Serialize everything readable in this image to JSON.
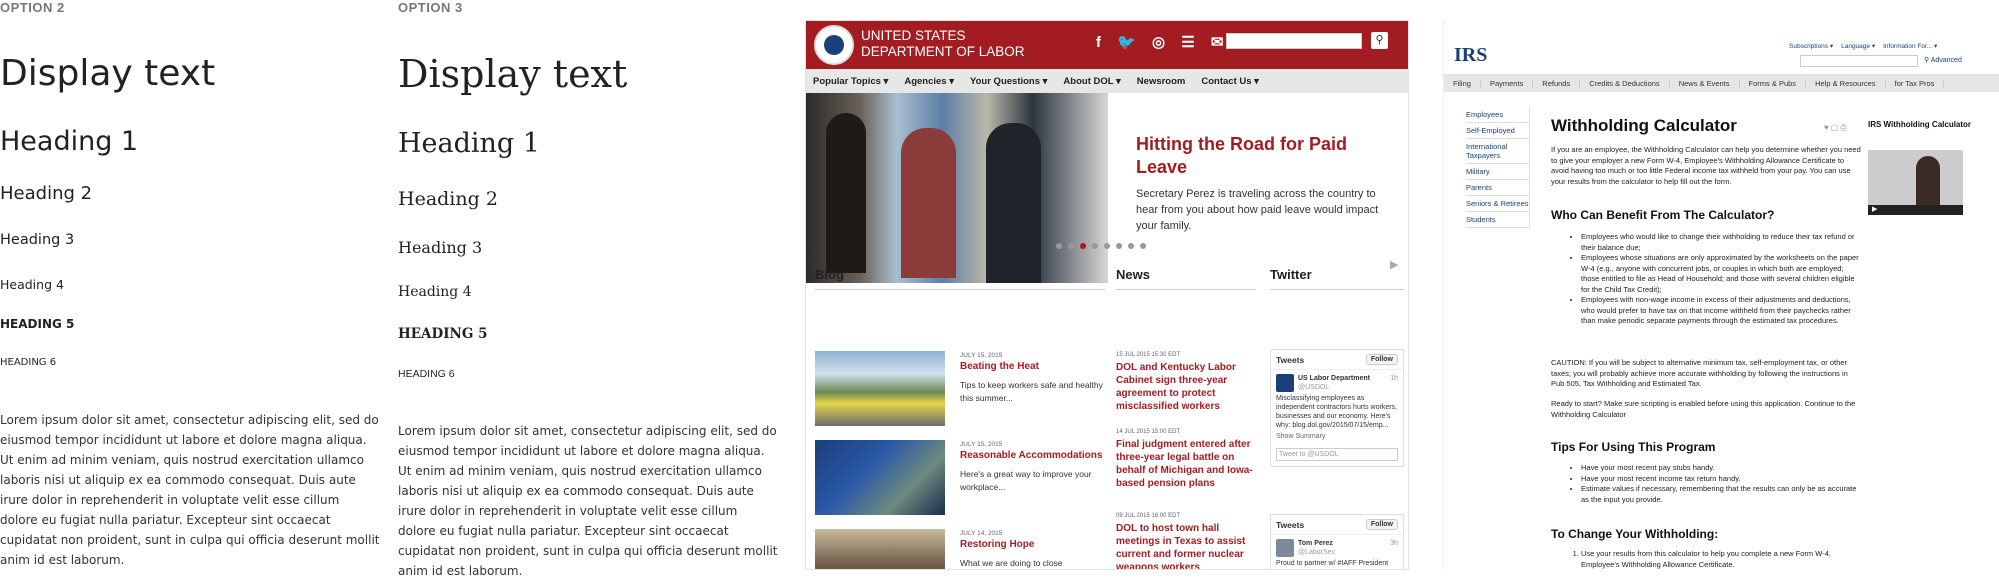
{
  "typography": {
    "option2": {
      "label": "OPTION 2",
      "display": "Display text",
      "h1": "Heading 1",
      "h2": "Heading 2",
      "h3": "Heading 3",
      "h4": "Heading 4",
      "h5": "HEADING 5",
      "h6": "HEADING 6",
      "body": "Lorem ipsum dolor sit amet, consectetur adipiscing elit, sed do eiusmod tempor incididunt ut labore et dolore magna aliqua. Ut enim ad minim veniam, quis nostrud exercitation ullamco laboris nisi ut aliquip ex ea commodo consequat. Duis aute irure dolor in reprehenderit in voluptate velit esse cillum dolore eu fugiat nulla pariatur. Excepteur sint occaecat cupidatat non proident, sunt in culpa qui officia deserunt mollit anim id est laborum."
    },
    "option3": {
      "label": "OPTION 3",
      "display": "Display text",
      "h1": "Heading 1",
      "h2": "Heading 2",
      "h3": "Heading 3",
      "h4": "Heading 4",
      "h5": "HEADING 5",
      "h6": "HEADING 6",
      "body": "Lorem ipsum dolor sit amet, consectetur adipiscing elit, sed do eiusmod tempor incididunt ut labore et dolore magna aliqua. Ut enim ad minim veniam, quis nostrud exercitation ullamco laboris nisi ut aliquip ex ea commodo consequat. Duis aute irure dolor in reprehenderit in voluptate velit esse cillum dolore eu fugiat nulla pariatur. Excepteur sint occaecat cupidatat non proident, sunt in culpa qui officia deserunt mollit anim id est laborum."
    }
  },
  "dol": {
    "brand_line1": "UNITED STATES",
    "brand_line2": "DEPARTMENT OF LABOR",
    "social_icons": "f 🐦 ◎ ☰ ✉",
    "nav": [
      "Popular Topics ▾",
      "Agencies ▾",
      "Your Questions ▾",
      "About DOL ▾",
      "Newsroom",
      "Contact Us ▾"
    ],
    "hero_title": "Hitting the Road for Paid Leave",
    "hero_text": "Secretary Perez is traveling across the country to hear from you about how paid leave would impact your family.",
    "blog_title": "Blog",
    "news_title": "News",
    "twitter_title": "Twitter",
    "blog": [
      {
        "date": "JULY 15, 2015",
        "title": "Beating the Heat",
        "text": "Tips to keep workers safe and healthy this summer..."
      },
      {
        "date": "JULY 15, 2015",
        "title": "Reasonable Accommodations",
        "text": "Here's a great way to improve your workplace..."
      },
      {
        "date": "JULY 14, 2015",
        "title": "Restoring Hope",
        "text": "What we are doing to close"
      }
    ],
    "news": [
      {
        "date": "15 JUL 2015 15:30 EDT",
        "title": "DOL and Kentucky Labor Cabinet sign three-year agreement to protect misclassified workers"
      },
      {
        "date": "14 JUL 2015 15:00 EDT",
        "title": "Final judgment entered after three-year legal battle on behalf of Michigan and Iowa-based pension plans"
      },
      {
        "date": "09 JUL 2015 16:00 EDT",
        "title": "DOL to host town hall meetings in Texas to assist current and former nuclear weapons workers"
      }
    ],
    "tweets": [
      {
        "label": "Tweets",
        "follow": "Follow",
        "name": "US Labor Department",
        "handle": "@USDOL",
        "time": "1h",
        "text": "Misclassifying employees as independent contractors hurts workers, businesses and our economy. Here's why: blog.dol.gov/2015/07/15/emp...",
        "summary": "Show Summary",
        "input": "Tweet to @USDOL"
      },
      {
        "label": "Tweets",
        "follow": "Follow",
        "name": "Tom Perez",
        "handle": "@LaborSec",
        "time": "3h",
        "text": "Proud to partner w/ #IAFF President Harold Schaitberger on new ways to"
      }
    ]
  },
  "irs": {
    "logo": "IRS",
    "top_links": [
      "Subscriptions ▾",
      "Language ▾",
      "Information For... ▾"
    ],
    "advanced": "Advanced",
    "nav": [
      "Filing",
      "Payments",
      "Refunds",
      "Credits & Deductions",
      "News & Events",
      "Forms & Pubs",
      "Help & Resources",
      "for Tax Pros"
    ],
    "side": [
      "Employees",
      "Self-Employed",
      "International Taxpayers",
      "Military",
      "Parents",
      "Seniors & Retirees",
      "Students"
    ],
    "title": "Withholding Calculator",
    "right_title": "IRS Withholding Calculator",
    "intro": "If you are an employee, the Withholding Calculator can help you determine whether you need to give your employer a new Form W-4, Employee's Withholding Allowance Certificate to avoid having too much or too little Federal income tax withheld from your pay. You can use your results from the calculator to help fill out the form.",
    "h_who": "Who Can Benefit From The Calculator?",
    "who": [
      "Employees who would like to change their withholding to reduce their tax refund or their balance due;",
      "Employees whose situations are only approximated by the worksheets on the paper W-4 (e.g., anyone with concurrent jobs, or couples in which both are employed; those entitled to file as Head of Household; and those with several children eligible for the Child Tax Credit);",
      "Employees with non-wage income in excess of their adjustments and deductions, who would prefer to have tax on that income withheld from their paychecks rather than make periodic separate payments through the estimated tax procedures."
    ],
    "caution": "CAUTION: If you will be subject to alternative minimum tax, self-employment tax, or other taxes; you will probably achieve more accurate withholding by following the instructions in Pub 505, Tax Withholding and Estimated Tax.",
    "ready": "Ready to start? Make sure scripting is enabled before using this application. Continue to the Withholding Calculator",
    "h_tips": "Tips For Using This Program",
    "tips": [
      "Have your most recent pay stubs handy.",
      "Have your most recent income tax return handy.",
      "Estimate values if necessary, remembering that the results can only be as accurate as the input you provide."
    ],
    "h_change": "To Change Your Withholding:",
    "change": [
      "Use your results from this calculator to help you complete a new Form W-4, Employee's Withholding Allowance Certificate."
    ]
  }
}
